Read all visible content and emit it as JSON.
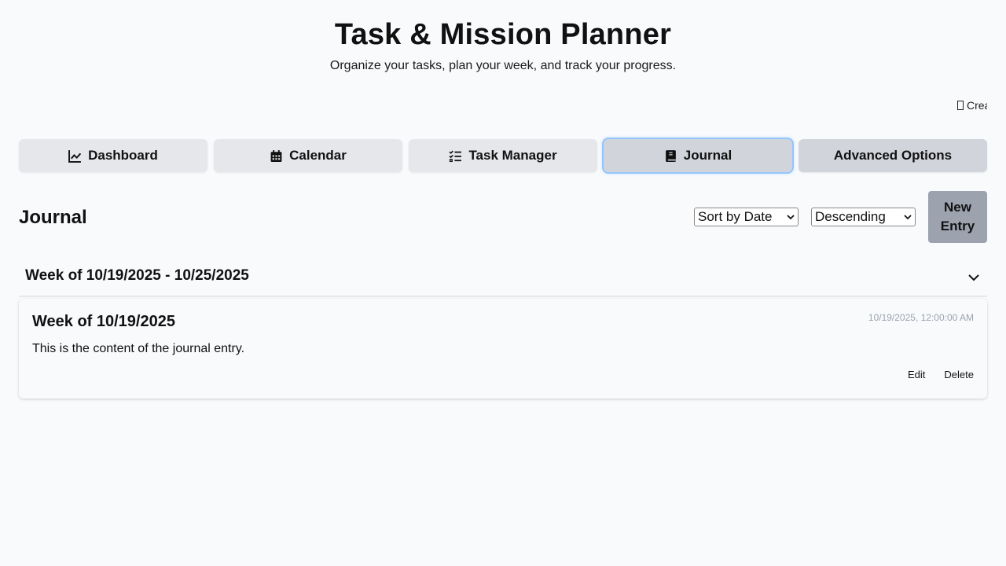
{
  "header": {
    "title": "Task & Mission Planner",
    "subtitle": "Organize your tasks, plan your week, and track your progress."
  },
  "marquee": {
    "text": "Crea"
  },
  "tabs": [
    {
      "label": "Dashboard",
      "icon": "chart-line-icon"
    },
    {
      "label": "Calendar",
      "icon": "calendar-icon"
    },
    {
      "label": "Task Manager",
      "icon": "task-list-icon"
    },
    {
      "label": "Journal",
      "icon": "journal-book-icon",
      "active": true
    },
    {
      "label": "Advanced Options",
      "icon": ""
    }
  ],
  "journal": {
    "title": "Journal",
    "sort_select": "Sort by Date",
    "order_select": "Descending",
    "new_entry_label": "New Entry"
  },
  "week_group": {
    "title": "Week of 10/19/2025 - 10/25/2025"
  },
  "entries": [
    {
      "title": "Week of 10/19/2025",
      "timestamp": "10/19/2025, 12:00:00 AM",
      "content": "This is the content of the journal entry.",
      "edit_label": "Edit",
      "delete_label": "Delete"
    }
  ],
  "colors": {
    "background": "#f8fafc",
    "tab": "#e5e7eb",
    "tab_active": "#d1d5db",
    "focus_ring": "#93c5fd",
    "new_entry_button": "#9ca3af",
    "timestamp": "#9ca3af"
  }
}
